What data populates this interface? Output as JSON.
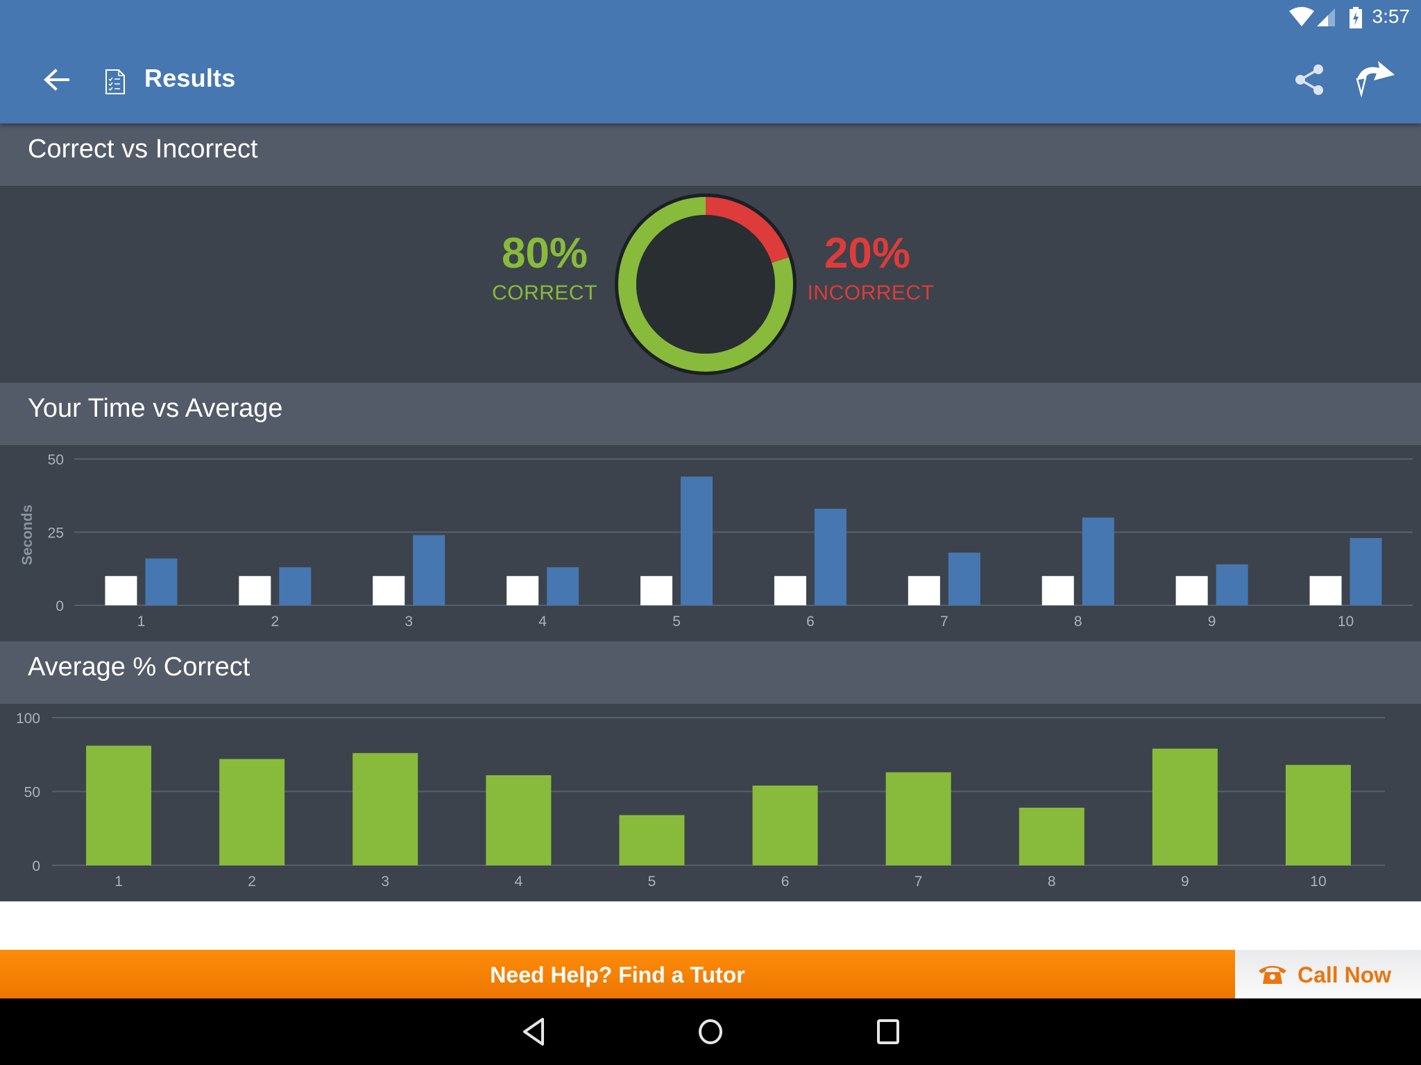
{
  "status_bar": {
    "time": "3:57",
    "icons": [
      "wifi-icon",
      "signal-icon",
      "battery-charging-icon"
    ]
  },
  "app_bar": {
    "title": "Results",
    "icons": {
      "back": "arrow-left-icon",
      "title": "checklist-document-icon",
      "share": "share-icon",
      "forward": "forward-arrow-icon"
    }
  },
  "sections": {
    "correct_vs_incorrect": {
      "title": "Correct vs Incorrect",
      "correct_percent": "80%",
      "correct_label": "CORRECT",
      "incorrect_percent": "20%",
      "incorrect_label": "INCORRECT"
    },
    "time_vs_average": {
      "title": "Your Time vs Average"
    },
    "average_correct": {
      "title": "Average % Correct"
    }
  },
  "colors": {
    "accent_blue": "#4677b1",
    "correct_green": "#88bb3b",
    "incorrect_red": "#de3b3b",
    "orange": "#f8840a",
    "your_time_white": "#ffffff"
  },
  "chart_data": [
    {
      "type": "pie",
      "title": "Correct vs Incorrect",
      "categories": [
        "Correct",
        "Incorrect"
      ],
      "values": [
        80,
        20
      ],
      "style": "donut"
    },
    {
      "type": "bar",
      "title": "Your Time vs Average",
      "categories": [
        "1",
        "2",
        "3",
        "4",
        "5",
        "6",
        "7",
        "8",
        "9",
        "10"
      ],
      "series": [
        {
          "name": "Your Time",
          "color": "#ffffff",
          "values": [
            10,
            10,
            10,
            10,
            10,
            10,
            10,
            10,
            10,
            10
          ]
        },
        {
          "name": "Average",
          "color": "#4677b1",
          "values": [
            16,
            13,
            24,
            13,
            44,
            33,
            18,
            30,
            14,
            23
          ]
        }
      ],
      "xlabel": "",
      "ylabel": "Seconds",
      "ylim": [
        0,
        50
      ],
      "yticks": [
        0,
        25,
        50
      ],
      "grid": true
    },
    {
      "type": "bar",
      "title": "Average % Correct",
      "categories": [
        "1",
        "2",
        "3",
        "4",
        "5",
        "6",
        "7",
        "8",
        "9",
        "10"
      ],
      "values": [
        81,
        72,
        76,
        61,
        34,
        54,
        63,
        39,
        79,
        68
      ],
      "color": "#88bb3b",
      "xlabel": "",
      "ylabel": "",
      "ylim": [
        0,
        100
      ],
      "yticks": [
        0,
        50,
        100
      ],
      "grid": true
    }
  ],
  "footer": {
    "tutor_label": "Need Help? Find a Tutor",
    "call_label": "Call Now",
    "call_icon": "phone-icon"
  },
  "nav": {
    "icons": [
      "nav-back-icon",
      "nav-home-icon",
      "nav-recents-icon"
    ]
  }
}
